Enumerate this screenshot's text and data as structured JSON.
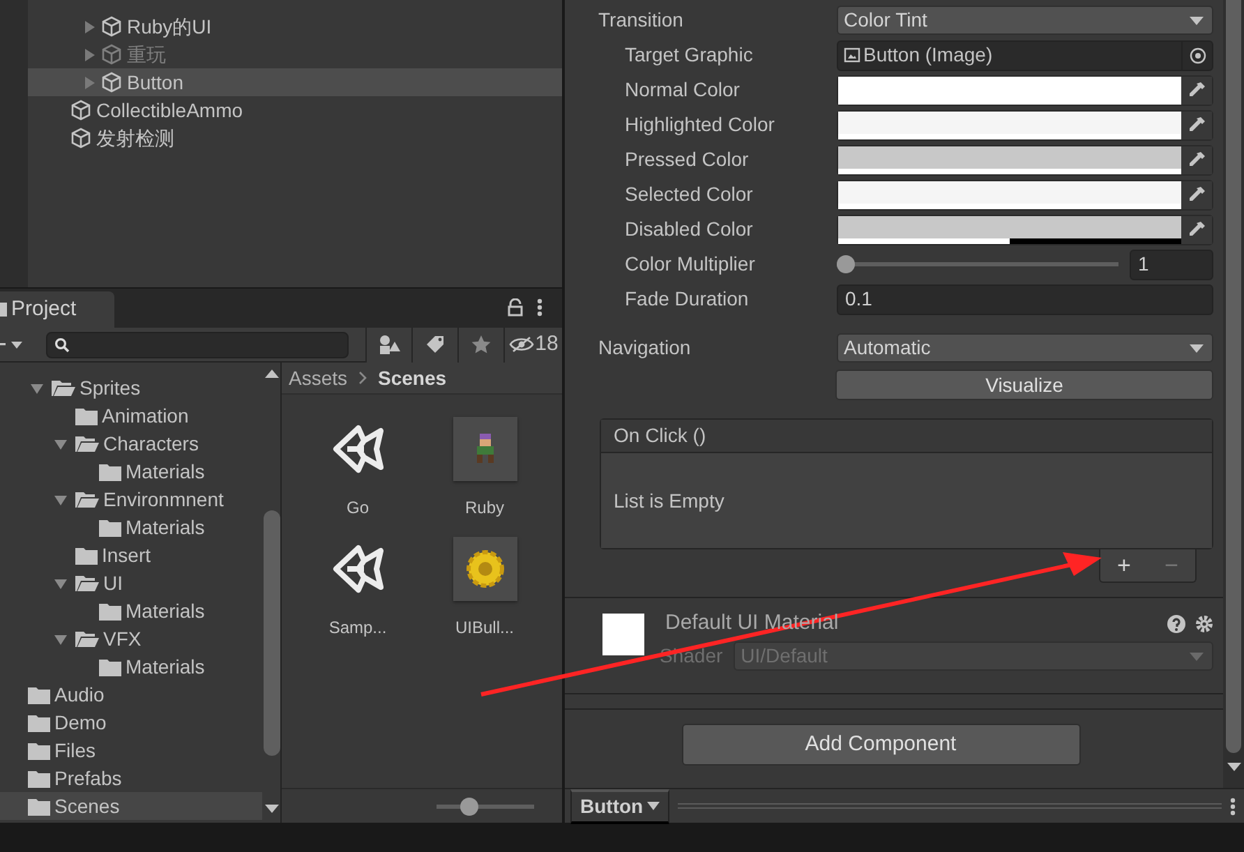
{
  "hierarchy": {
    "items": [
      {
        "label": "Ruby的UI",
        "expandable": true,
        "active": true,
        "selected": false
      },
      {
        "label": "重玩",
        "expandable": true,
        "active": false,
        "selected": false
      },
      {
        "label": "Button",
        "expandable": true,
        "active": true,
        "selected": true
      },
      {
        "label": "CollectibleAmmo",
        "expandable": false,
        "active": true,
        "selected": false
      },
      {
        "label": "发射检测",
        "expandable": false,
        "active": true,
        "selected": false
      }
    ]
  },
  "project": {
    "tab": "Project",
    "hidden_count": "18",
    "nested_tree": [
      {
        "label": "Sprites",
        "expanded": true,
        "selected": false,
        "children": [
          {
            "label": "Animation",
            "expanded": false,
            "selected": false
          },
          {
            "label": "Characters",
            "expanded": true,
            "selected": false,
            "children": [
              {
                "label": "Materials",
                "expanded": false,
                "selected": false
              }
            ]
          },
          {
            "label": "Environmnent",
            "expanded": true,
            "selected": false,
            "children": [
              {
                "label": "Materials",
                "expanded": false,
                "selected": false
              }
            ]
          },
          {
            "label": "Insert",
            "expanded": false,
            "selected": false
          },
          {
            "label": "UI",
            "expanded": true,
            "selected": false,
            "children": [
              {
                "label": "Materials",
                "expanded": false,
                "selected": false
              }
            ]
          },
          {
            "label": "VFX",
            "expanded": true,
            "selected": false,
            "children": [
              {
                "label": "Materials",
                "expanded": false,
                "selected": false
              }
            ]
          }
        ]
      }
    ],
    "tree": [
      {
        "label": "Audio",
        "expanded": false,
        "selected": false
      },
      {
        "label": "Demo",
        "expanded": false,
        "selected": false
      },
      {
        "label": "Files",
        "expanded": false,
        "selected": false
      },
      {
        "label": "Prefabs",
        "expanded": false,
        "selected": false
      },
      {
        "label": "Scenes",
        "expanded": false,
        "selected": true
      }
    ],
    "breadcrumb": [
      {
        "label": "Assets",
        "current": false
      },
      {
        "label": "Scenes",
        "current": true
      }
    ],
    "assets": [
      {
        "label": "Go",
        "kind": "scene"
      },
      {
        "label": "Ruby",
        "kind": "character"
      },
      {
        "label": "Samp...",
        "kind": "scene"
      },
      {
        "label": "UIBull...",
        "kind": "gear"
      }
    ],
    "zoom_slider": {
      "level": 0.33
    }
  },
  "inspector": {
    "fields": [
      {
        "label": "Transition",
        "kind": "dropdown",
        "value": "Color Tint",
        "children": [
          {
            "label": "Target Graphic",
            "kind": "object",
            "value": "Button (Image)"
          },
          {
            "label": "Normal Color",
            "kind": "color",
            "color": "#ffffff",
            "level": 1
          },
          {
            "label": "Highlighted Color",
            "kind": "color",
            "color": "#f5f5f5",
            "level": 1
          },
          {
            "label": "Pressed Color",
            "kind": "color",
            "color": "#c8c8c8",
            "level": 1
          },
          {
            "label": "Selected Color",
            "kind": "color",
            "color": "#f5f5f5",
            "level": 1
          },
          {
            "label": "Disabled Color",
            "kind": "color",
            "color": "#c8c8c8",
            "level": 0.5
          },
          {
            "label": "Color Multiplier",
            "kind": "slider",
            "level": 0,
            "value": "1"
          },
          {
            "label": "Fade Duration",
            "kind": "number",
            "value": "0.1"
          }
        ]
      },
      {
        "label": "Navigation",
        "kind": "dropdown",
        "value": "Automatic"
      }
    ],
    "visualize_button": "Visualize",
    "on_click": {
      "title": "On Click ()",
      "empty_text": "List is Empty",
      "buttons": [
        {
          "label": "+",
          "disabled": false
        },
        {
          "label": "−",
          "disabled": true
        }
      ]
    },
    "material": {
      "title": "Default UI Material",
      "shader_label": "Shader",
      "shader": "UI/Default",
      "shader_disabled": true
    },
    "add_component": "Add Component",
    "footer": {
      "label": "Button"
    }
  }
}
